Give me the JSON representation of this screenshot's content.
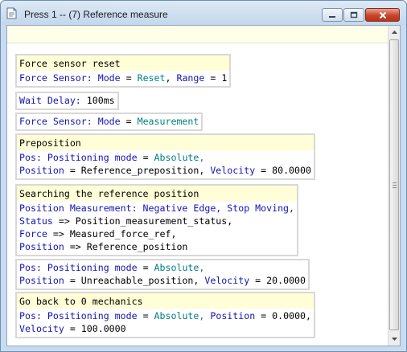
{
  "window": {
    "title": "Press 1 -- (7) Reference measure",
    "controls": {
      "minimize": "minimize",
      "maximize": "maximize",
      "close": "close"
    }
  },
  "blocks": [
    {
      "header": "Force sensor reset",
      "lines": [
        [
          {
            "t": "Force Sensor: Mode",
            "c": "blue"
          },
          {
            "t": " = ",
            "c": "black"
          },
          {
            "t": "Reset",
            "c": "teal"
          },
          {
            "t": ", ",
            "c": "black"
          },
          {
            "t": "Range",
            "c": "blue"
          },
          {
            "t": " = 1",
            "c": "black"
          }
        ]
      ]
    },
    {
      "header": "",
      "lines": [
        [
          {
            "t": "Wait Delay:",
            "c": "blue"
          },
          {
            "t": " 100ms",
            "c": "black"
          }
        ]
      ]
    },
    {
      "header": "",
      "lines": [
        [
          {
            "t": "Force Sensor: Mode",
            "c": "blue"
          },
          {
            "t": " = ",
            "c": "black"
          },
          {
            "t": "Measurement",
            "c": "teal"
          }
        ]
      ]
    },
    {
      "header": "Preposition",
      "lines": [
        [
          {
            "t": "Pos: Positioning mode",
            "c": "blue"
          },
          {
            "t": " = ",
            "c": "black"
          },
          {
            "t": "Absolute,",
            "c": "teal"
          }
        ],
        [
          {
            "t": "Position",
            "c": "blue"
          },
          {
            "t": " = Reference_preposition, ",
            "c": "black"
          },
          {
            "t": "Velocity",
            "c": "blue"
          },
          {
            "t": " = 80.0000",
            "c": "black"
          }
        ]
      ]
    },
    {
      "header": "Searching the reference position",
      "lines": [
        [
          {
            "t": "Position Measurement: Negative Edge, Stop Moving,",
            "c": "blue"
          }
        ],
        [
          {
            "t": "Status",
            "c": "blue"
          },
          {
            "t": " => Position_measurement_status,",
            "c": "black"
          }
        ],
        [
          {
            "t": "Force",
            "c": "blue"
          },
          {
            "t": " => Measured_force_ref,",
            "c": "black"
          }
        ],
        [
          {
            "t": "Position",
            "c": "blue"
          },
          {
            "t": " => Reference_position",
            "c": "black"
          }
        ]
      ]
    },
    {
      "header": "",
      "lines": [
        [
          {
            "t": "Pos: Positioning mode",
            "c": "blue"
          },
          {
            "t": " = ",
            "c": "black"
          },
          {
            "t": "Absolute,",
            "c": "teal"
          }
        ],
        [
          {
            "t": "Position",
            "c": "blue"
          },
          {
            "t": " = Unreachable_position, ",
            "c": "black"
          },
          {
            "t": "Velocity",
            "c": "blue"
          },
          {
            "t": " = 20.0000",
            "c": "black"
          }
        ]
      ]
    },
    {
      "header": "Go back to 0 mechanics",
      "lines": [
        [
          {
            "t": "Pos: Positioning mode",
            "c": "blue"
          },
          {
            "t": " = ",
            "c": "black"
          },
          {
            "t": "Absolute,",
            "c": "teal"
          },
          {
            "t": " ",
            "c": "black"
          },
          {
            "t": "Position",
            "c": "blue"
          },
          {
            "t": " = 0.0000,",
            "c": "black"
          }
        ],
        [
          {
            "t": "Velocity",
            "c": "blue"
          },
          {
            "t": " = 100.0000",
            "c": "black"
          }
        ]
      ]
    }
  ],
  "colors": {
    "keyword": "#1414b4",
    "value": "#008080",
    "header_bg": "#fffed6",
    "block_border": "#d8d8d8"
  },
  "icons": {
    "app": "document-icon",
    "scroll_up": "arrow-up-icon",
    "scroll_down": "arrow-down-icon"
  }
}
